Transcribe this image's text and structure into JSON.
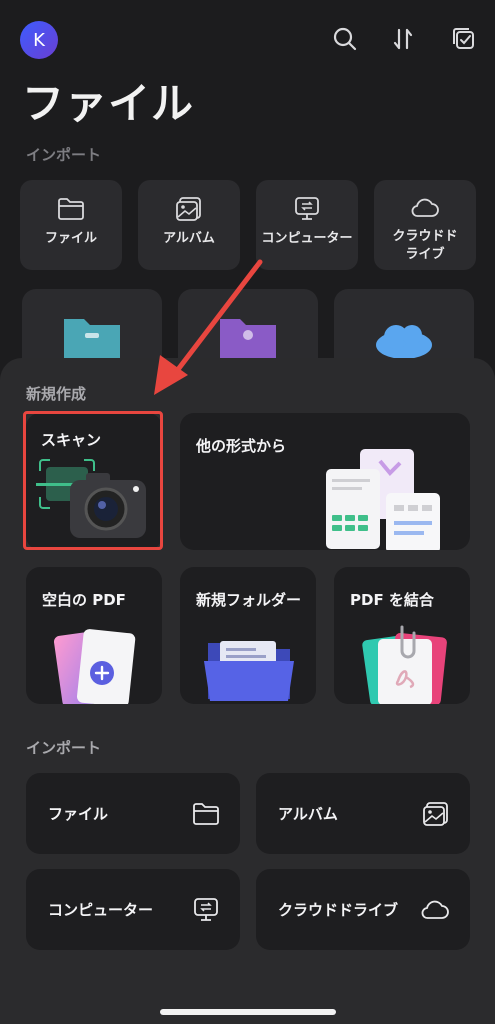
{
  "header": {
    "avatar_letter": "K",
    "title": "ファイル"
  },
  "bg_import": {
    "label": "インポート",
    "tiles": [
      {
        "label": "ファイル",
        "icon": "folder-icon"
      },
      {
        "label": "アルバム",
        "icon": "album-icon"
      },
      {
        "label": "コンピューター",
        "icon": "computer-transfer-icon"
      },
      {
        "label": "クラウドドライブ",
        "icon": "cloud-icon"
      }
    ]
  },
  "create": {
    "label": "新規作成",
    "scan": "スキャン",
    "other_format": "他の形式から",
    "blank_pdf": "空白の PDF",
    "new_folder": "新規フォルダー",
    "merge_pdf": "PDF を結合"
  },
  "import": {
    "label": "インポート",
    "file": "ファイル",
    "album": "アルバム",
    "computer": "コンピューター",
    "cloud": "クラウドドライブ"
  },
  "colors": {
    "background": "#1c1c1e",
    "sheet": "#2b2b2d",
    "card": "#1e1e20",
    "highlight": "#e8463f",
    "accent": "#5b5fe0"
  }
}
